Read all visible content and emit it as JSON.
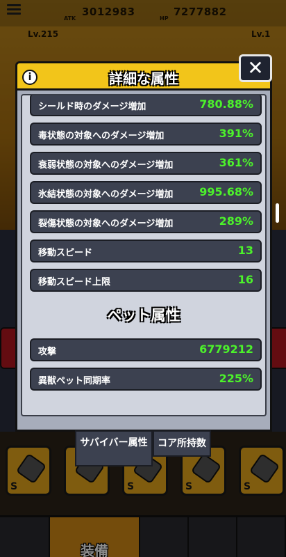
{
  "hud": {
    "atk_value": "3012983",
    "atk_label": "ATK",
    "hp_value": "7277882",
    "hp_label": "HP",
    "left_level": "Lv.215",
    "right_level": "Lv.1"
  },
  "dialog": {
    "title": "詳細な属性",
    "info_icon": "i",
    "close_icon": "✕",
    "attributes": [
      {
        "label": "シールド時のダメージ増加",
        "value": "780.88%"
      },
      {
        "label": "毒状態の対象へのダメージ増加",
        "value": "391%"
      },
      {
        "label": "衰弱状態の対象へのダメージ増加",
        "value": "361%"
      },
      {
        "label": "氷結状態の対象へのダメージ増加",
        "value": "995.68%"
      },
      {
        "label": "裂傷状態の対象へのダメージ増加",
        "value": "289%"
      },
      {
        "label": "移動スピード",
        "value": "13"
      },
      {
        "label": "移動スピード上限",
        "value": "16"
      }
    ],
    "pet_section_title": "ペット属性",
    "pet_attributes": [
      {
        "label": "攻撃",
        "value": "6779212"
      },
      {
        "label": "異獣ペット同期率",
        "value": "225%"
      }
    ]
  },
  "tabs": {
    "survivor": "サバイバー属性",
    "core": "コア所持数"
  },
  "nav": {
    "equip_label": "装備"
  },
  "colors": {
    "header": "#f2c51a",
    "value_green": "#4cf22b",
    "row_bg": "#3c4150"
  }
}
